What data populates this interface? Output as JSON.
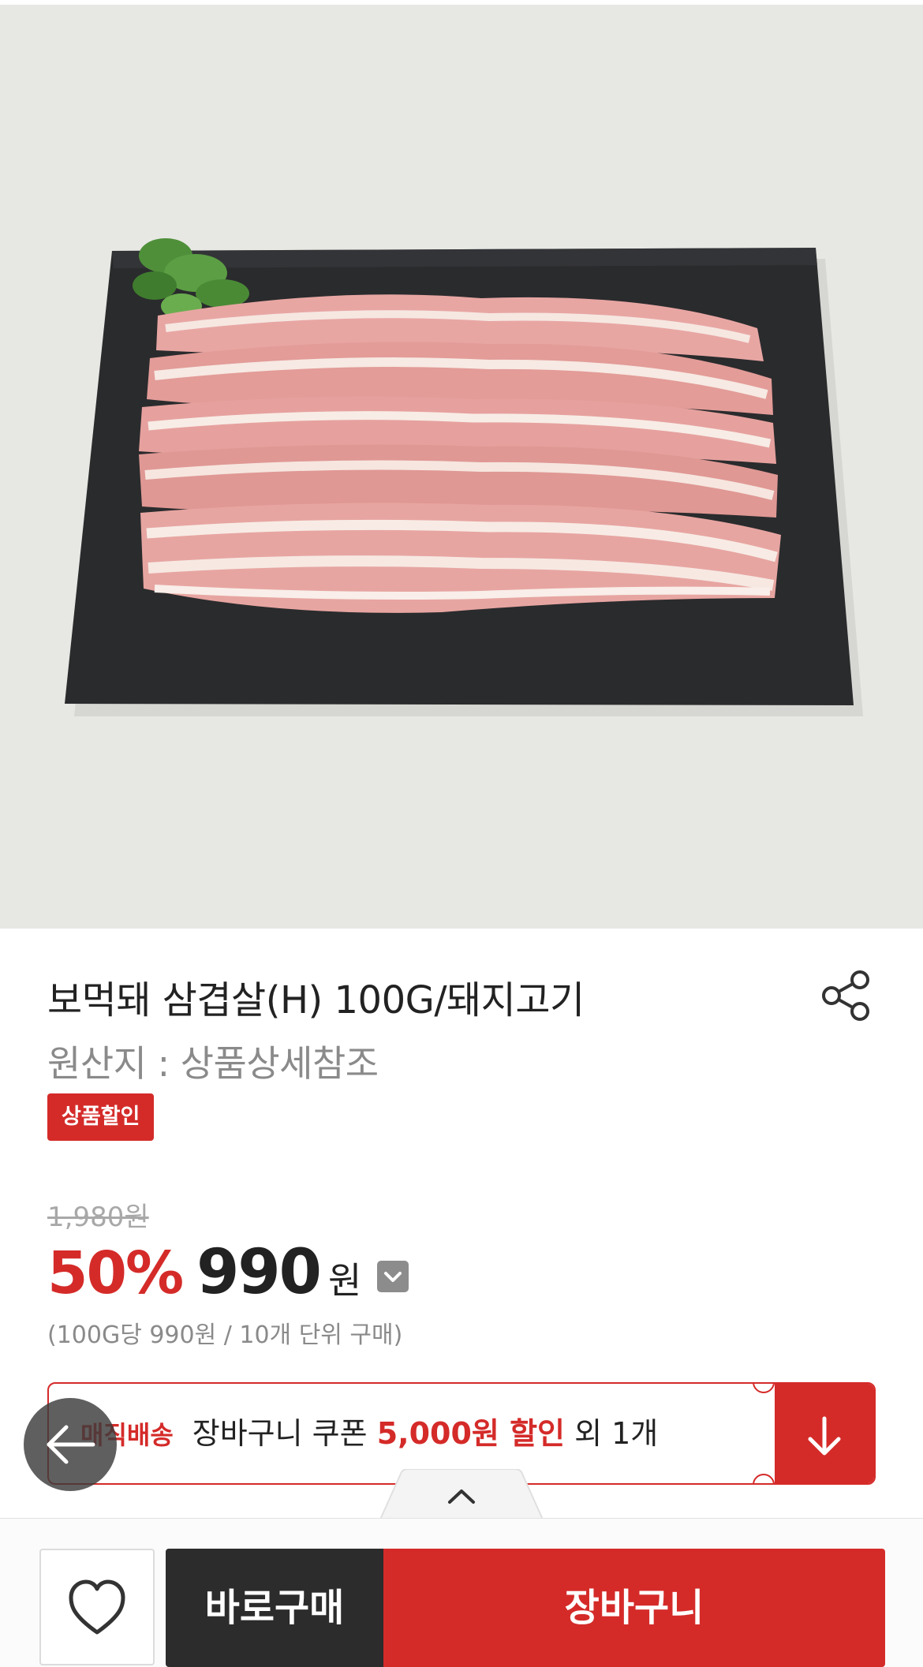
{
  "product": {
    "image_alt": "보먹돼 삼겹살 상품 이미지",
    "title": "보먹돼 삼겹살(H) 100G/돼지고기",
    "origin": "원산지 : 상품상세참조",
    "badge": "상품할인",
    "original_price": "1,980원",
    "discount_rate": "50%",
    "sale_price": "990",
    "currency": "원",
    "unit_note": "(100G당 990원 / 10개 단위 구매)"
  },
  "coupon": {
    "tag": "매직배송",
    "text_prefix": "장바구니 쿠폰 ",
    "amount": "5,000원 할인",
    "text_suffix": " 외 1개"
  },
  "actions": {
    "buy_now": "바로구매",
    "cart": "장바구니"
  },
  "icons": {
    "share": "share-icon",
    "price_toggle": "chevron-down-icon",
    "coupon_expand": "arrow-down-icon",
    "back": "arrow-left-icon",
    "handle": "chevron-up-icon",
    "wishlist": "heart-icon"
  },
  "colors": {
    "accent": "#d42b29",
    "dark_button": "#2c2c2c",
    "hero_background": "#e7e8e3"
  }
}
